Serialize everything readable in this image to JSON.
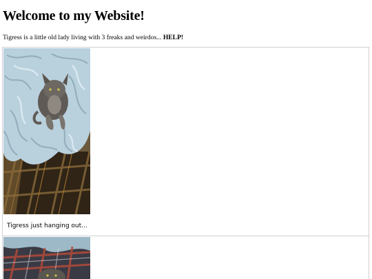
{
  "page": {
    "title": "Welcome to my Website!",
    "intro_text": "Tigress is a little old lady living with 3 freaks and weirdos...",
    "intro_emphasis": "HELP!"
  },
  "gallery": {
    "items": [
      {
        "caption": "Tigress just hanging out...",
        "image_subject": "grey cat lying on a pale blue blanket on a plaid couch"
      },
      {
        "caption": "",
        "image_subject": "plaid flannel fabric with a cat partially visible"
      }
    ]
  }
}
